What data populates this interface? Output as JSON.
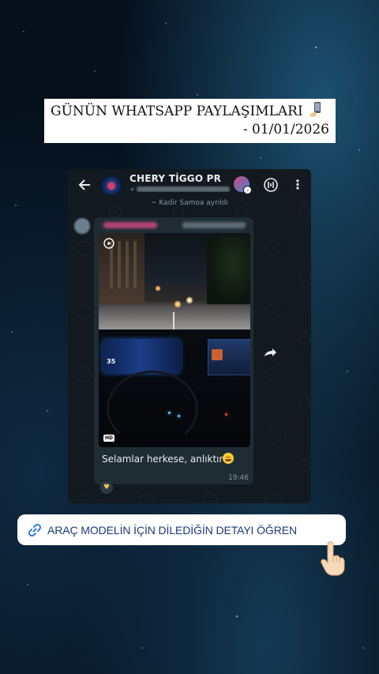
{
  "banner": {
    "title": "GÜNÜN WHATSAPP PAYLAŞIMLARI",
    "date": "- 01/01/2026"
  },
  "chat": {
    "group_name": "CHERY TİGGO PR",
    "system_note": "~ Kadir Samoa ayrıldı",
    "message": {
      "text": "Selamlar herkese, anlıktır",
      "time": "19:46",
      "media_badge": "HD",
      "speed_readout": "35"
    }
  },
  "cta": {
    "label": "ARAÇ MODELİN İÇİN DİLEDİĞİN DETAYI ÖĞREN"
  },
  "icons": {
    "back": "arrow-left-icon",
    "call": "call-add-icon",
    "menu": "more-vert-icon",
    "forward": "forward-icon",
    "play": "video-play-icon",
    "link": "link-icon",
    "hand": "pointing-hand-icon",
    "phone": "phone-icon"
  },
  "colors": {
    "accent_link": "#2a7be4",
    "text_dark": "#183a7a",
    "chat_bg": "#121a20",
    "bubble_bg": "#1f2c34"
  }
}
